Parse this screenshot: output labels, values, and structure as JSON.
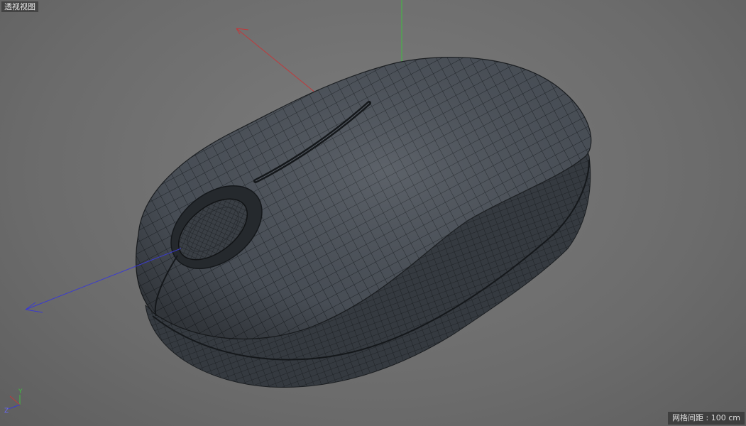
{
  "viewport": {
    "view_name": "透视视图",
    "grid_spacing_label": "网格间距 : 100 cm"
  },
  "gizmo": {
    "y_label": "Y",
    "z_label": "Z"
  },
  "colors": {
    "x_axis": "#c0393b",
    "y_axis": "#3fbf3f",
    "z_axis": "#3a3ad0",
    "background": "#6f6f6f",
    "mesh_fill": "#4a5058",
    "mesh_wire": "#1e2226"
  },
  "icons": {
    "axis_gizmo": "axis-orientation-icon"
  }
}
